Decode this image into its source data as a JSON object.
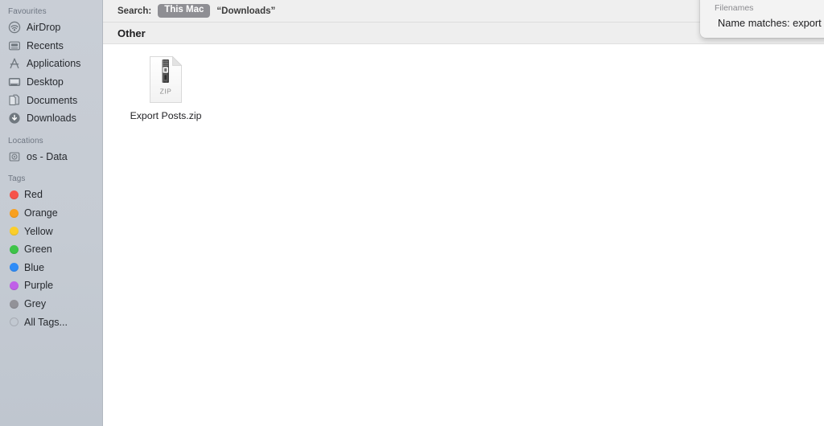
{
  "sidebar": {
    "sections": [
      {
        "title": "Favourites",
        "items": [
          {
            "label": "AirDrop",
            "icon": "airdrop-icon"
          },
          {
            "label": "Recents",
            "icon": "recents-icon"
          },
          {
            "label": "Applications",
            "icon": "applications-icon"
          },
          {
            "label": "Desktop",
            "icon": "desktop-icon"
          },
          {
            "label": "Documents",
            "icon": "documents-icon"
          },
          {
            "label": "Downloads",
            "icon": "downloads-icon"
          }
        ]
      },
      {
        "title": "Locations",
        "items": [
          {
            "label": "os - Data",
            "icon": "hard-drive-icon"
          }
        ]
      },
      {
        "title": "Tags",
        "items": [
          {
            "label": "Red",
            "icon": "tag-dot-icon",
            "color": "#f6534a"
          },
          {
            "label": "Orange",
            "icon": "tag-dot-icon",
            "color": "#f8a01f"
          },
          {
            "label": "Yellow",
            "icon": "tag-dot-icon",
            "color": "#fbce2b"
          },
          {
            "label": "Green",
            "icon": "tag-dot-icon",
            "color": "#3ec449"
          },
          {
            "label": "Blue",
            "icon": "tag-dot-icon",
            "color": "#2f8cf7"
          },
          {
            "label": "Purple",
            "icon": "tag-dot-icon",
            "color": "#c060e8"
          },
          {
            "label": "Grey",
            "icon": "tag-dot-icon",
            "color": "#929298"
          },
          {
            "label": "All Tags...",
            "icon": "all-tags-icon",
            "color": ""
          }
        ]
      }
    ]
  },
  "search": {
    "label": "Search:",
    "scope_selected": "This Mac",
    "scope_folder": "“Downloads”"
  },
  "results": {
    "group_title": "Other",
    "files": [
      {
        "name": "Export Posts.zip",
        "icon": "zip-file-icon",
        "badge": "ZIP"
      }
    ]
  },
  "popover": {
    "section_title": "Filenames",
    "rows": [
      {
        "text": "Name matches: export posts.zip"
      }
    ]
  }
}
